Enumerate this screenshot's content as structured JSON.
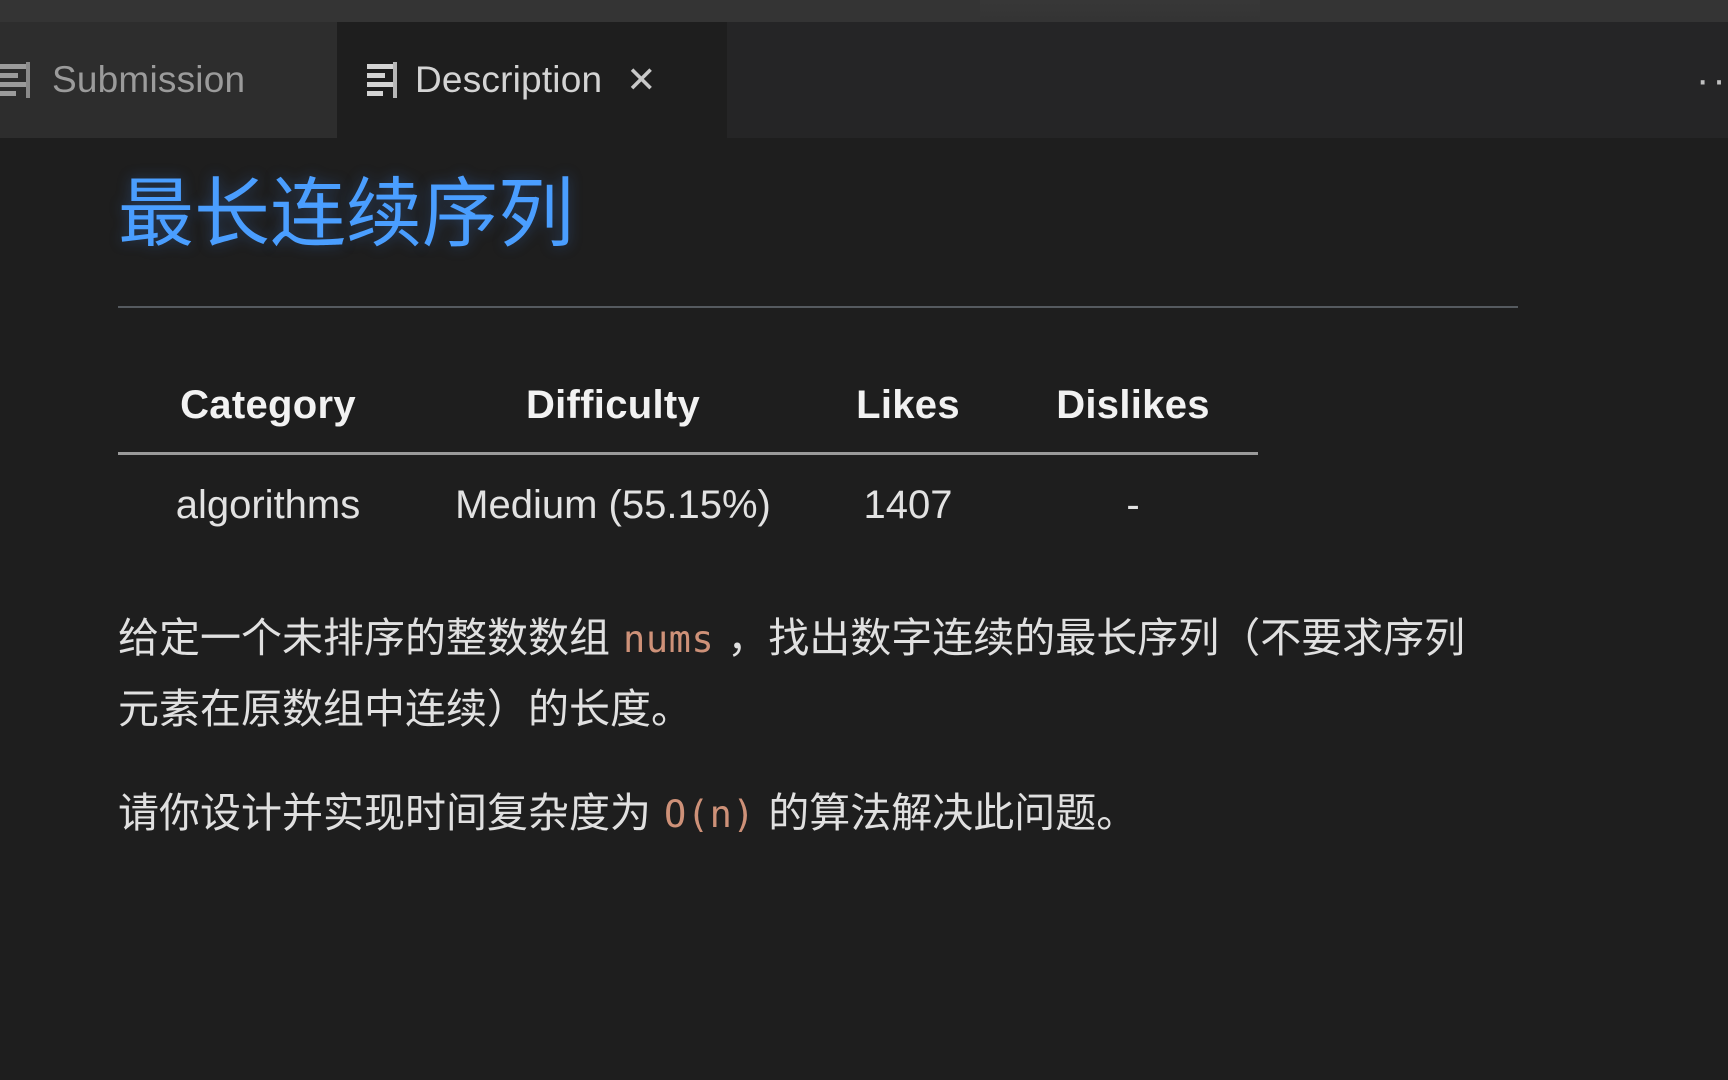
{
  "window": {
    "background_color": "#1e1e1e",
    "titlebar_color": "#343434"
  },
  "tabbar": {
    "overflow_label": "···",
    "tabs": [
      {
        "label": "Submission",
        "icon": "document-lines-icon",
        "active": false,
        "closable": false
      },
      {
        "label": "Description",
        "icon": "document-lines-icon",
        "active": true,
        "closable": true,
        "close_label": "✕"
      }
    ]
  },
  "problem": {
    "title": "最长连续序列",
    "title_color": "#4a9eff",
    "table": {
      "headers": [
        "Category",
        "Difficulty",
        "Likes",
        "Dislikes"
      ],
      "rows": [
        [
          "algorithms",
          "Medium (55.15%)",
          "1407",
          "-"
        ]
      ]
    },
    "paragraphs": [
      {
        "parts": [
          {
            "type": "text",
            "value": "给定一个未排序的整数数组 "
          },
          {
            "type": "code",
            "value": "nums"
          },
          {
            "type": "text",
            "value": " ，找出数字连续的最长序列（不要求序列元素在原数组中连续）的长度。"
          }
        ]
      },
      {
        "parts": [
          {
            "type": "text",
            "value": "请你设计并实现时间复杂度为 "
          },
          {
            "type": "code",
            "value": "O(n)"
          },
          {
            "type": "text",
            "value": " 的算法解决此问题。"
          }
        ]
      }
    ],
    "code_color": "#ce9178"
  },
  "p1": {
    "lead": "给定一个未排序的整数数组 ",
    "code": "nums",
    "tail": " ，找出数字连续的最长序列（不要求序列元素在原数组中连续）的长度。"
  },
  "p2": {
    "lead": "请你设计并实现时间复杂度为 ",
    "code": "O(n)",
    "tail": " 的算法解决此问题。"
  }
}
